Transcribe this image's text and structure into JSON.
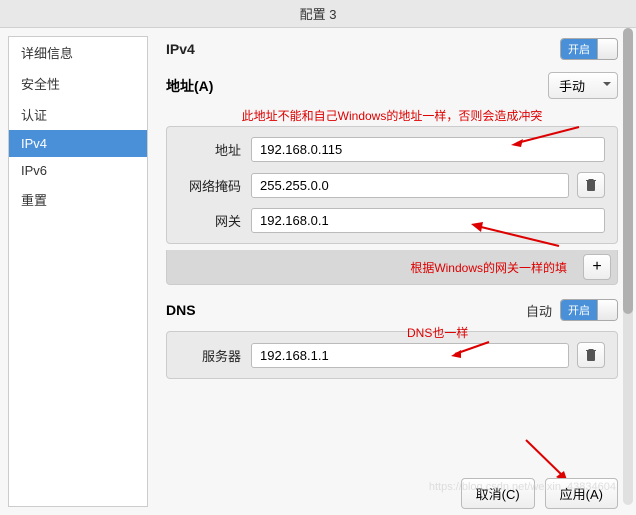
{
  "title": "配置 3",
  "sidebar": {
    "items": [
      {
        "label": "详细信息"
      },
      {
        "label": "安全性"
      },
      {
        "label": "认证"
      },
      {
        "label": "IPv4"
      },
      {
        "label": "IPv6"
      },
      {
        "label": "重置"
      }
    ]
  },
  "ipv4": {
    "heading": "IPv4",
    "toggle_on": "开启",
    "addresses_label": "地址(A)",
    "method": "手动",
    "note_conflict": "此地址不能和自己Windows的地址一样，否则会造成冲突",
    "rows": {
      "address_label": "地址",
      "address_value": "192.168.0.115",
      "netmask_label": "网络掩码",
      "netmask_value": "255.255.0.0",
      "gateway_label": "网关",
      "gateway_value": "192.168.0.1"
    },
    "note_gateway": "根据Windows的网关一样的填"
  },
  "dns": {
    "heading": "DNS",
    "auto_label": "自动",
    "toggle_on": "开启",
    "server_label": "服务器",
    "server_value": "192.168.1.1",
    "note": "DNS也一样"
  },
  "footer": {
    "cancel": "取消(C)",
    "apply": "应用(A)"
  },
  "watermark": "https://blog.csdn.net/weixin_43834604"
}
